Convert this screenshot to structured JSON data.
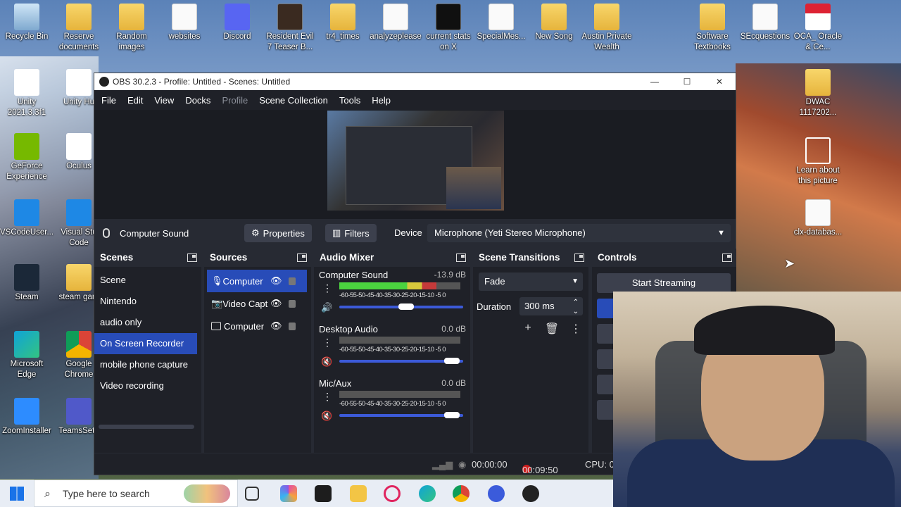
{
  "desktop": {
    "icons": [
      {
        "label": "Recycle Bin",
        "icon": "recycle-bin-icon"
      },
      {
        "label": "Reserve documents",
        "icon": "folder-icon"
      },
      {
        "label": "Random images",
        "icon": "folder-icon"
      },
      {
        "label": "websites",
        "icon": "document-icon"
      },
      {
        "label": "Discord",
        "icon": "discord-icon"
      },
      {
        "label": "Resident Evil 7 Teaser B...",
        "icon": "game-icon"
      },
      {
        "label": "tr4_times",
        "icon": "folder-icon"
      },
      {
        "label": "analyzeplease",
        "icon": "document-icon"
      },
      {
        "label": "current stats on X",
        "icon": "image-icon"
      },
      {
        "label": "SpecialMes...",
        "icon": "document-icon"
      },
      {
        "label": "New Song",
        "icon": "folder-icon"
      },
      {
        "label": "Austin Private Wealth",
        "icon": "folder-icon"
      },
      {
        "label": "Software Textbooks",
        "icon": "folder-icon"
      },
      {
        "label": "SEcquestions",
        "icon": "document-icon"
      },
      {
        "label": "OCA_ Oracle & Ce...",
        "icon": "pdf-icon"
      },
      {
        "label": "Unity 2021.3.3f1",
        "icon": "unity-icon"
      },
      {
        "label": "Unity Hu",
        "icon": "unity-icon"
      },
      {
        "label": "DWAC 1117202...",
        "icon": "folder-icon"
      },
      {
        "label": "GeForce Experience",
        "icon": "nvidia-icon"
      },
      {
        "label": "Oculus",
        "icon": "oculus-icon"
      },
      {
        "label": "Learn about this picture",
        "icon": "info-icon"
      },
      {
        "label": "VSCodeUser...",
        "icon": "vscode-icon"
      },
      {
        "label": "Visual Stu Code",
        "icon": "vscode-icon"
      },
      {
        "label": "clx-databas...",
        "icon": "document-icon"
      },
      {
        "label": "Steam",
        "icon": "steam-icon"
      },
      {
        "label": "steam gam",
        "icon": "folder-icon"
      },
      {
        "label": "Microsoft Edge",
        "icon": "edge-icon"
      },
      {
        "label": "Google Chrome",
        "icon": "chrome-icon"
      },
      {
        "label": "ZoomInstaller",
        "icon": "zoom-icon"
      },
      {
        "label": "TeamsSetu",
        "icon": "teams-icon"
      }
    ]
  },
  "window": {
    "title": "OBS 30.2.3 - Profile: Untitled - Scenes: Untitled",
    "controls": {
      "minimize": "—",
      "maximize": "☐",
      "close": "✕"
    }
  },
  "menu": [
    "File",
    "Edit",
    "View",
    "Docks",
    "Profile",
    "Scene Collection",
    "Tools",
    "Help"
  ],
  "source_bar": {
    "source_name": "Computer Sound",
    "properties": "Properties",
    "filters": "Filters",
    "device_label": "Device",
    "device_value": "Microphone (Yeti Stereo Microphone)"
  },
  "scenes": {
    "title": "Scenes",
    "items": [
      "Scene",
      "Nintendo",
      "audio only",
      "On Screen Recorder",
      "mobile phone capture",
      "Video recording"
    ],
    "selected": "On Screen Recorder"
  },
  "sources": {
    "title": "Sources",
    "items": [
      {
        "label": "Computer",
        "icon": "microphone-icon",
        "selected": true
      },
      {
        "label": "Video Capt",
        "icon": "camera-icon",
        "selected": false
      },
      {
        "label": "Computer",
        "icon": "monitor-icon",
        "selected": false
      }
    ]
  },
  "mixer": {
    "title": "Audio Mixer",
    "scale": "-60-55-50-45-40-35-30-25-20-15-10 -5 0",
    "channels": [
      {
        "name": "Computer Sound",
        "db": "-13.9 dB",
        "level": 0.8,
        "volume": 0.6,
        "muted": false
      },
      {
        "name": "Desktop Audio",
        "db": "0.0 dB",
        "level": 0.0,
        "volume": 0.97,
        "muted": true
      },
      {
        "name": "Mic/Aux",
        "db": "0.0 dB",
        "level": 0.0,
        "volume": 0.97,
        "muted": true
      }
    ]
  },
  "transitions": {
    "title": "Scene Transitions",
    "type": "Fade",
    "duration_label": "Duration",
    "duration_value": "300 ms"
  },
  "controls": {
    "title": "Controls",
    "start_streaming": "Start Streaming"
  },
  "status": {
    "stream_time": "00:00:00",
    "rec_time": "00:09:50",
    "cpu": "CPU: 0"
  },
  "taskbar": {
    "search_placeholder": "Type here to search"
  }
}
